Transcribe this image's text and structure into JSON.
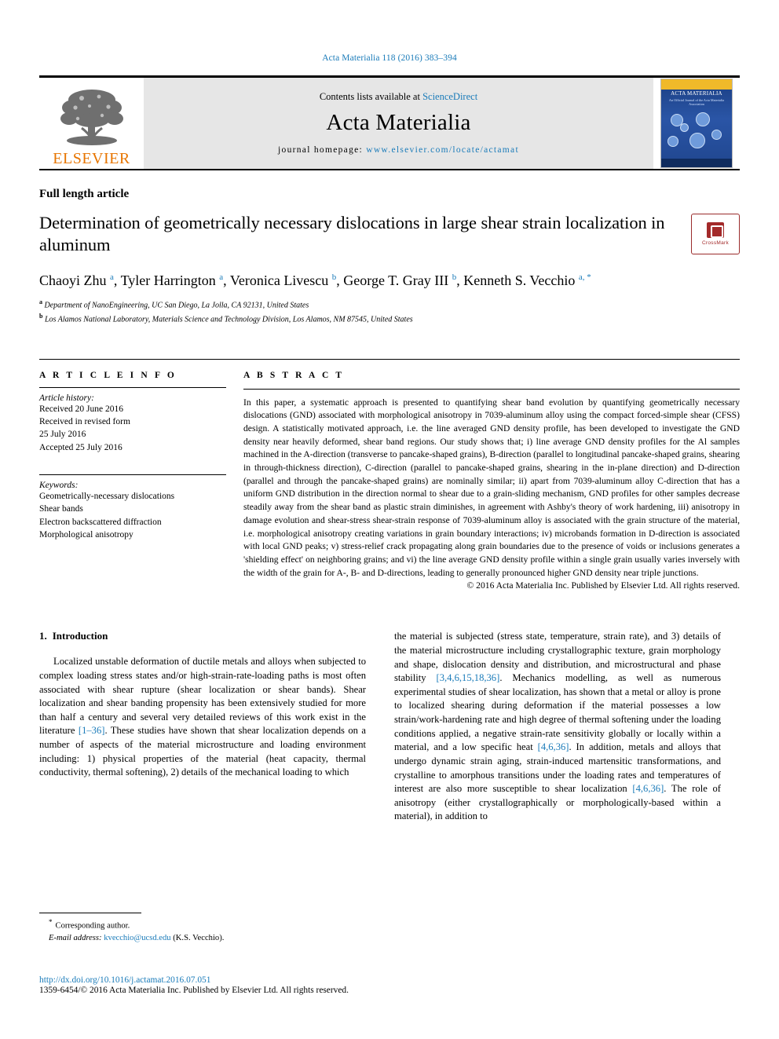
{
  "running_head": "Acta Materialia 118 (2016) 383–394",
  "masthead": {
    "publisher_logo_label": "ELSEVIER",
    "contents_prefix": "Contents lists available at ",
    "contents_link": "ScienceDirect",
    "journal_name": "Acta Materialia",
    "homepage_prefix": "journal homepage: ",
    "homepage_url": "www.elsevier.com/locate/actamat",
    "cover": {
      "title": "ACTA MATERIALIA",
      "subtitle": "An Official Journal of the Acta Materialia Association"
    }
  },
  "article": {
    "type": "Full length article",
    "title": "Determination of geometrically necessary dislocations in large shear strain localization in aluminum",
    "crossmark_label": "CrossMark",
    "authors_html": "Chaoyi Zhu <sup>a</sup>, Tyler Harrington <sup>a</sup>, Veronica Livescu <sup>b</sup>, George T. Gray III <sup>b</sup>, Kenneth S. Vecchio <sup>a, *</sup>",
    "affiliations": [
      {
        "mark": "a",
        "text": "Department of NanoEngineering, UC San Diego, La Jolla, CA 92131, United States"
      },
      {
        "mark": "b",
        "text": "Los Alamos National Laboratory, Materials Science and Technology Division, Los Alamos, NM 87545, United States"
      }
    ]
  },
  "article_info": {
    "heading": "A R T I C L E   I N F O",
    "history_label": "Article history:",
    "history_lines": [
      "Received 20 June 2016",
      "Received in revised form",
      "25 July 2016",
      "Accepted 25 July 2016"
    ],
    "keywords_label": "Keywords:",
    "keywords": [
      "Geometrically-necessary dislocations",
      "Shear bands",
      "Electron backscattered diffraction",
      "Morphological anisotropy"
    ]
  },
  "abstract": {
    "heading": "A B S T R A C T",
    "text": "In this paper, a systematic approach is presented to quantifying shear band evolution by quantifying geometrically necessary dislocations (GND) associated with morphological anisotropy in 7039-aluminum alloy using the compact forced-simple shear (CFSS) design. A statistically motivated approach, i.e. the line averaged GND density profile, has been developed to investigate the GND density near heavily deformed, shear band regions. Our study shows that; i) line average GND density profiles for the Al samples machined in the A-direction (transverse to pancake-shaped grains), B-direction (parallel to longitudinal pancake-shaped grains, shearing in through-thickness direction), C-direction (parallel to pancake-shaped grains, shearing in the in-plane direction) and D-direction (parallel and through the pancake-shaped grains) are nominally similar; ii) apart from 7039-aluminum alloy C-direction that has a uniform GND distribution in the direction normal to shear due to a grain-sliding mechanism, GND profiles for other samples decrease steadily away from the shear band as plastic strain diminishes, in agreement with Ashby's theory of work hardening, iii) anisotropy in damage evolution and shear-stress shear-strain response of 7039-aluminum alloy is associated with the grain structure of the material, i.e. morphological anisotropy creating variations in grain boundary interactions; iv) microbands formation in D-direction is associated with local GND peaks; v) stress-relief crack propagating along grain boundaries due to the presence of voids or inclusions generates a 'shielding effect' on neighboring grains; and vi) the line average GND density profile within a single grain usually varies inversely with the width of the grain for A-, B- and D-directions, leading to generally pronounced higher GND density near triple junctions.",
    "copyright": "© 2016 Acta Materialia Inc. Published by Elsevier Ltd. All rights reserved."
  },
  "introduction": {
    "number": "1.",
    "title": "Introduction",
    "left_paragraph_html": "Localized unstable deformation of ductile metals and alloys when subjected to complex loading stress states and/or high-strain-rate-loading paths is most often associated with shear rupture (shear localization or shear bands). Shear localization and shear banding propensity has been extensively studied for more than half a century and several very detailed reviews of this work exist in the literature <span class=\"ref\">[1–36]</span>. These studies have shown that shear localization depends on a number of aspects of the material microstructure and loading environment including: 1) physical properties of the material (heat capacity, thermal conductivity, thermal softening), 2) details of the mechanical loading to which",
    "right_paragraph_html": "the material is subjected (stress state, temperature, strain rate), and 3) details of the material microstructure including crystallographic texture, grain morphology and shape, dislocation density and distribution, and microstructural and phase stability <span class=\"ref\">[3,4,6,15,18,36]</span>. Mechanics modelling, as well as numerous experimental studies of shear localization, has shown that a metal or alloy is prone to localized shearing during deformation if the material possesses a low strain/work-hardening rate and high degree of thermal softening under the loading conditions applied, a negative strain-rate sensitivity globally or locally within a material, and a low specific heat <span class=\"ref\">[4,6,36]</span>. In addition, metals and alloys that undergo dynamic strain aging, strain-induced martensitic transformations, and crystalline to amorphous transitions under the loading rates and temperatures of interest are also more susceptible to shear localization <span class=\"ref\">[4,6,36]</span>. The role of anisotropy (either crystallographically or morphologically-based within a material), in addition to"
  },
  "footnote": {
    "corresponding_label": "Corresponding author.",
    "email_label": "E-mail address:",
    "email": "kvecchio@ucsd.edu",
    "email_owner": "(K.S. Vecchio)."
  },
  "footer": {
    "doi": "http://dx.doi.org/10.1016/j.actamat.2016.07.051",
    "issn_line": "1359-6454/© 2016 Acta Materialia Inc. Published by Elsevier Ltd. All rights reserved."
  },
  "colors": {
    "link": "#1a7bb9",
    "elsevier_orange": "#E77500",
    "masthead_gray": "#e6e6e6"
  }
}
